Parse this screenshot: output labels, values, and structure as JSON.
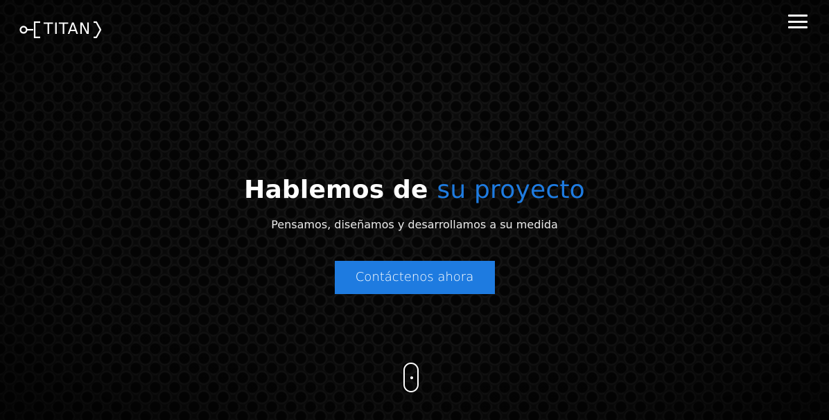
{
  "brand": {
    "logo_left": "C[",
    "logo_text": "TITAN",
    "logo_right": ">"
  },
  "nav": {
    "menu_icon": "hamburger-icon"
  },
  "hero": {
    "title_main": "Hablemos de",
    "title_accent": "su proyecto",
    "subtitle": "Pensamos, diseñamos y desarrollamos a su medida",
    "cta_label": "Contáctenos ahora",
    "scroll_icon": "mouse-scroll-icon"
  },
  "colors": {
    "accent": "#1e7be0",
    "background": "#0c0c0c",
    "text": "#ffffff"
  }
}
